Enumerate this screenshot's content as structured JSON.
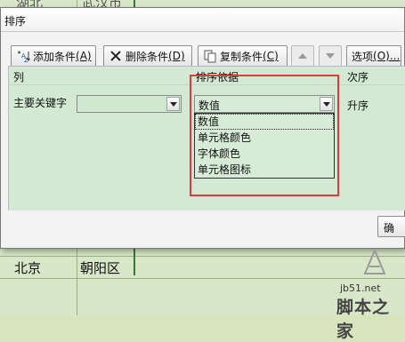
{
  "sheet": {
    "top_partial_1": "湖北",
    "top_partial_2": "武汉市",
    "cell_city": "北京",
    "cell_district": "朝阳区"
  },
  "dialog": {
    "title": "排序",
    "toolbar": {
      "add_label": "添加条件",
      "add_key": "(A)",
      "delete_label": "删除条件",
      "delete_key": "(D)",
      "copy_label": "复制条件",
      "copy_key": "(C)",
      "options_label": "选项",
      "options_key": "(O)..."
    },
    "headers": {
      "column": "列",
      "sort_on": "排序依据",
      "order": "次序"
    },
    "row": {
      "label": "主要关键字",
      "column_value": "",
      "sort_on_value": "数值",
      "order_value": "升序"
    },
    "sort_on_options": [
      "数值",
      "单元格颜色",
      "字体颜色",
      "单元格图标"
    ],
    "ok_label": "确"
  },
  "watermark": {
    "site": "jb51.net",
    "name": "脚本之家"
  },
  "colors": {
    "highlight": "#e23a3a",
    "grid_bg": "#d4e9d4"
  }
}
